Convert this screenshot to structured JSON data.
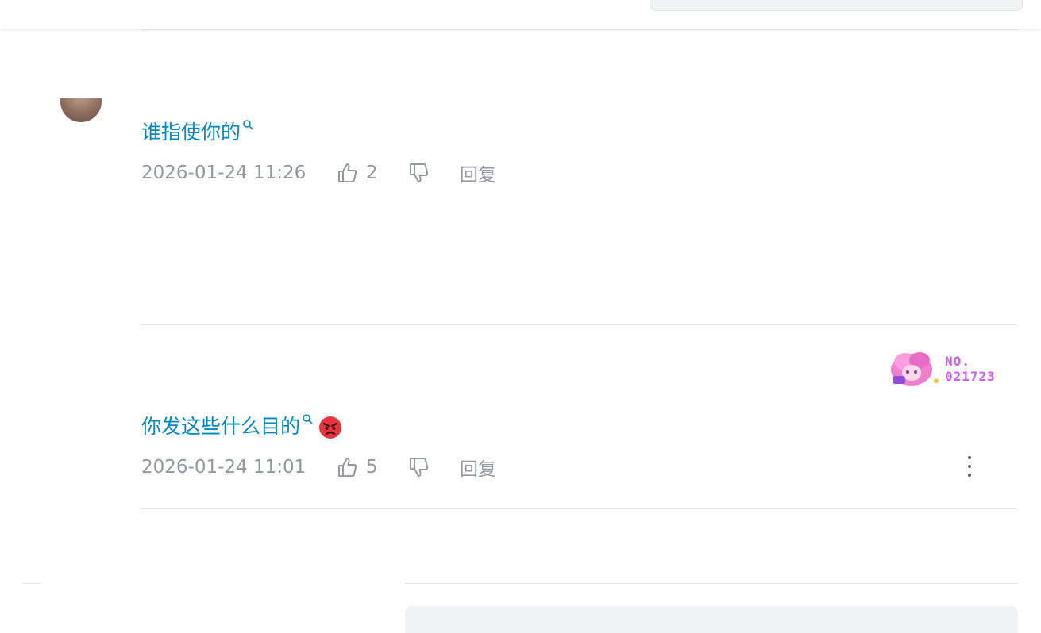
{
  "header": {
    "logo_icon": "bilibili-logo-icon",
    "search_placeholder": ""
  },
  "comments": [
    {
      "text": "谁指使你的",
      "keyword_icon": "search-icon",
      "time": "2026-01-24 11:26",
      "likes": "2",
      "reply_label": "回复",
      "avatar_icon": "avatar"
    },
    {
      "text": "你发这些什么目的",
      "keyword_icon": "search-icon",
      "emoji": "angry-face-emoji",
      "time": "2026-01-24 11:01",
      "likes": "5",
      "reply_label": "回复",
      "badge_number": "NO.",
      "badge_id": "021723",
      "more_icon": "more-vertical-icon"
    }
  ],
  "colors": {
    "link": "#008ac5",
    "meta": "#9499a0",
    "divider": "#e3e5e7",
    "badge_text": "#d45cf0"
  }
}
